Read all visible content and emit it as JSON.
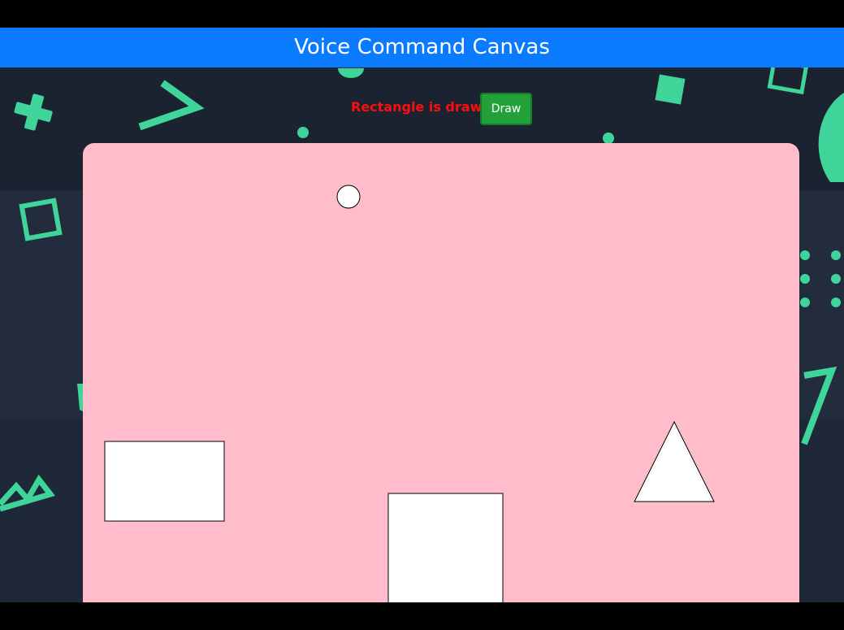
{
  "app": {
    "title": "Voice Command Canvas"
  },
  "status": {
    "message": "Rectangle is drawn"
  },
  "controls": {
    "draw_label": "Draw"
  },
  "canvas": {
    "shapes": [
      "circle",
      "rectangle",
      "square",
      "triangle"
    ]
  },
  "colors": {
    "header": "#0a7bff",
    "status_text": "#ff0d0d",
    "draw_button": "#22a03a",
    "canvas": "#ffbccb",
    "decor_accent": "#3fd49a",
    "background": "#1f2838"
  }
}
